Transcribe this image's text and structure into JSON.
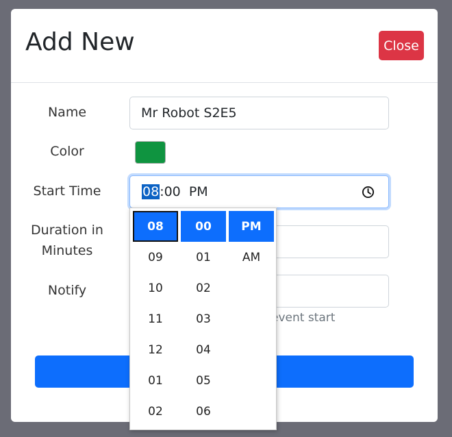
{
  "modal": {
    "title": "Add New",
    "close_label": "Close"
  },
  "form": {
    "name_label": "Name",
    "name_value": "Mr Robot S2E5",
    "color_label": "Color",
    "color_value": "#0f9440",
    "start_time_label": "Start Time",
    "start_time_hours": "08",
    "start_time_rest": ":00  PM",
    "duration_label_line1": "Duration in",
    "duration_label_line2": "Minutes",
    "notify_label": "Notify",
    "notify_helper": "event start"
  },
  "time_picker": {
    "hours": [
      "08",
      "09",
      "10",
      "11",
      "12",
      "01",
      "02"
    ],
    "minutes": [
      "00",
      "01",
      "02",
      "03",
      "04",
      "05",
      "06"
    ],
    "periods": [
      "PM",
      "AM"
    ],
    "selected": {
      "hour": "08",
      "minute": "00",
      "period": "PM"
    }
  },
  "colors": {
    "primary": "#0d6efd",
    "danger": "#dc3545",
    "backdrop": "#6b6c76"
  }
}
